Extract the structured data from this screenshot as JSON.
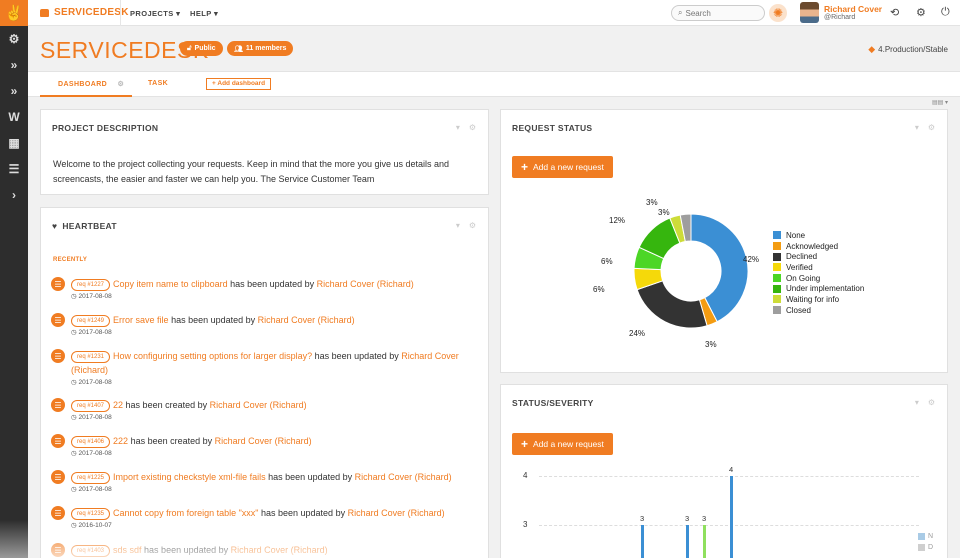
{
  "brand": {
    "name": "SERVICEDESK"
  },
  "menu": [
    {
      "label": "PROJECTS ▾"
    },
    {
      "label": "HELP ▾"
    }
  ],
  "search": {
    "placeholder": "Search"
  },
  "user": {
    "name": "Richard Cover",
    "handle": "@Richard"
  },
  "header": {
    "title": "SERVICEDESK",
    "public_label": "Public",
    "members_label": "11 members",
    "version": "4.Production/Stable"
  },
  "tabs": [
    {
      "label": "DASHBOARD"
    },
    {
      "label": "TASK"
    }
  ],
  "add_dashboard_label": "Add dashboard",
  "project_description": {
    "title": "PROJECT DESCRIPTION",
    "text": "Welcome to the project collecting your requests. Keep in mind that the more you give us details and screencasts, the easier and faster we can help you. The Service Customer Team"
  },
  "heartbeat": {
    "title": "HEARTBEAT",
    "recently": "RECENTLY",
    "items": [
      {
        "tag": "req #1227",
        "link": "Copy item name to clipboard",
        "action": " has been updated by ",
        "user": "Richard Cover (Richard)",
        "date": "2017-08-08"
      },
      {
        "tag": "req #1249",
        "link": "Error save file",
        "action": " has been updated by ",
        "user": "Richard Cover (Richard)",
        "date": "2017-08-08"
      },
      {
        "tag": "req #1231",
        "link": "How configuring setting options for larger display?",
        "action": " has been updated by ",
        "user": "Richard Cover (Richard)",
        "date": "2017-08-08"
      },
      {
        "tag": "req #1407",
        "link": "22",
        "action": " has been created by ",
        "user": "Richard Cover (Richard)",
        "date": "2017-08-08"
      },
      {
        "tag": "req #1406",
        "link": "222",
        "action": " has been created by ",
        "user": "Richard Cover (Richard)",
        "date": "2017-08-08"
      },
      {
        "tag": "req #1225",
        "link": "Import existing checkstyle xml-file fails",
        "action": " has been updated by ",
        "user": "Richard Cover (Richard)",
        "date": "2017-08-08"
      },
      {
        "tag": "req #1235",
        "link": "Cannot copy from foreign table \"xxx\"",
        "action": " has been updated by ",
        "user": "Richard Cover (Richard)",
        "date": "2016-10-07"
      },
      {
        "tag": "req #1403",
        "link": "sds sdf",
        "action": " has been updated by ",
        "user": "Richard Cover (Richard)",
        "date": ""
      }
    ]
  },
  "request_status": {
    "title": "REQUEST STATUS",
    "button": "Add a new request"
  },
  "status_severity": {
    "title": "STATUS/SEVERITY",
    "button": "Add a new request"
  },
  "colors": {
    "accent": "#f07c22",
    "sidebar": "#2d2d2d"
  },
  "chart_data": [
    {
      "type": "pie",
      "title": "",
      "donut": true,
      "legend_position": "right",
      "slices": [
        {
          "name": "None",
          "value": 42,
          "label": "42%",
          "color": "#3b8fd4"
        },
        {
          "name": "Acknowledged",
          "value": 3,
          "label": "3%",
          "color": "#f39c12"
        },
        {
          "name": "Declined",
          "value": 24,
          "label": "24%",
          "color": "#333333"
        },
        {
          "name": "Verified",
          "value": 6,
          "label": "6%",
          "color": "#f5d90a"
        },
        {
          "name": "On Going",
          "value": 6,
          "label": "6%",
          "color": "#4cd626"
        },
        {
          "name": "Under implementation",
          "value": 12,
          "label": "12%",
          "color": "#36b60e"
        },
        {
          "name": "Waiting for info",
          "value": 3,
          "label": "3%",
          "color": "#cddc39"
        },
        {
          "name": "Closed",
          "value": 3,
          "label": "3%",
          "color": "#9e9e9e"
        }
      ]
    },
    {
      "type": "bar",
      "title": "",
      "y_ticks": [
        "4",
        "3"
      ],
      "bars": [
        {
          "value": 3,
          "label": "3",
          "color": "#3b8fd4"
        },
        {
          "value": 3,
          "label": "3",
          "color": "#3b8fd4"
        },
        {
          "value": 3,
          "label": "3",
          "color": "#8fe05e"
        },
        {
          "value": 4,
          "label": "4",
          "color": "#3b8fd4"
        }
      ],
      "legend": [
        {
          "name": "N",
          "color": "#a9cbe6"
        },
        {
          "name": "D",
          "color": "#cfcfcf"
        }
      ]
    }
  ]
}
